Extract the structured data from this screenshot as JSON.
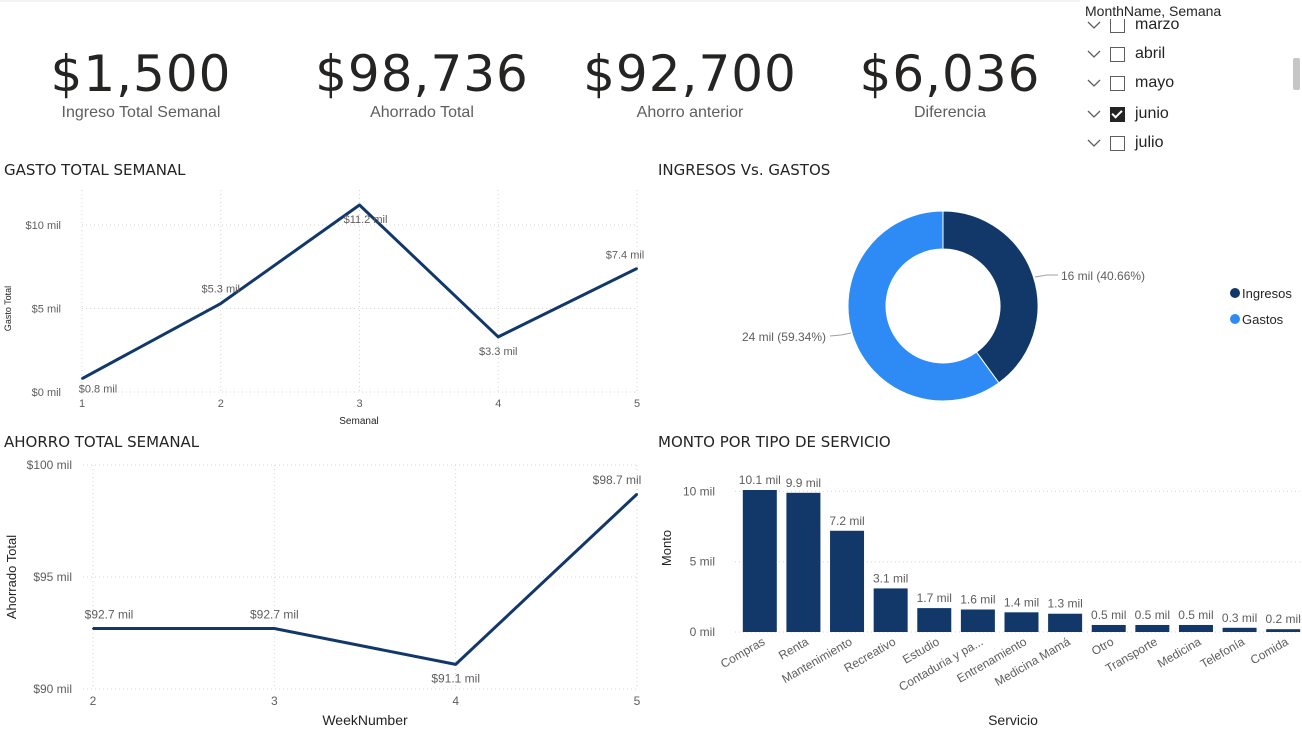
{
  "kpis": [
    {
      "value": "$1,500",
      "label": "Ingreso Total Semanal"
    },
    {
      "value": "$98,736",
      "label": "Ahorrado Total"
    },
    {
      "value": "$92,700",
      "label": "Ahorro anterior"
    },
    {
      "value": "$6,036",
      "label": "Diferencia"
    }
  ],
  "slicer": {
    "header": "MonthName, Semana",
    "items": [
      {
        "label": "marzo",
        "checked": false
      },
      {
        "label": "abril",
        "checked": false
      },
      {
        "label": "mayo",
        "checked": false
      },
      {
        "label": "junio",
        "checked": true
      },
      {
        "label": "julio",
        "checked": false
      }
    ]
  },
  "colors": {
    "dark_blue": "#12386A",
    "light_blue": "#2E8BF6",
    "grid": "#d6d6d6"
  },
  "chart_data": [
    {
      "id": "gasto",
      "type": "line",
      "title": "GASTO TOTAL SEMANAL",
      "xlabel": "Semanal",
      "ylabel": "Gasto Total",
      "x": [
        1,
        2,
        3,
        4,
        5
      ],
      "values": [
        0.8,
        5.3,
        11.2,
        3.3,
        7.4
      ],
      "labels": [
        "$0.8 mil",
        "$5.3 mil",
        "$11.2 mil",
        "$3.3 mil",
        "$7.4 mil"
      ],
      "yticks": [
        0,
        5,
        10
      ],
      "ytick_labels": [
        "$0 mil",
        "$5 mil",
        "$10 mil"
      ],
      "ylim": [
        0,
        11.2
      ],
      "grid": true
    },
    {
      "id": "ahorro",
      "type": "line",
      "title": "AHORRO TOTAL SEMANAL",
      "xlabel": "WeekNumber",
      "ylabel": "Ahorrado Total",
      "x": [
        2,
        3,
        4,
        5
      ],
      "values": [
        92.7,
        92.7,
        91.1,
        98.7
      ],
      "labels": [
        "$92.7 mil",
        "$92.7 mil",
        "$91.1 mil",
        "$98.7 mil"
      ],
      "yticks": [
        90,
        95,
        100
      ],
      "ytick_labels": [
        "$90 mil",
        "$95 mil",
        "$100 mil"
      ],
      "ylim": [
        90,
        100
      ],
      "grid": true
    },
    {
      "id": "donut",
      "type": "pie",
      "title": "INGRESOS Vs. GASTOS",
      "series": [
        {
          "name": "Ingresos",
          "value": 16,
          "label": "16 mil (40.66%)",
          "color": "#12386A"
        },
        {
          "name": "Gastos",
          "value": 24,
          "label": "24 mil (59.34%)",
          "color": "#2E8BF6"
        }
      ],
      "legend": "right"
    },
    {
      "id": "monto",
      "type": "bar",
      "title": "MONTO POR TIPO DE SERVICIO",
      "xlabel": "Servicio",
      "ylabel": "Monto",
      "categories": [
        "Compras",
        "Renta",
        "Mantenimiento",
        "Recreativo",
        "Estudio",
        "Contaduria y pa...",
        "Entrenamiento",
        "Medicina Mamá",
        "Otro",
        "Transporte",
        "Medicina",
        "Telefonía",
        "Comida"
      ],
      "values": [
        10.1,
        9.9,
        7.2,
        3.1,
        1.7,
        1.6,
        1.4,
        1.3,
        0.5,
        0.5,
        0.5,
        0.3,
        0.2
      ],
      "labels": [
        "10.1 mil",
        "9.9 mil",
        "7.2 mil",
        "3.1 mil",
        "1.7 mil",
        "1.6 mil",
        "1.4 mil",
        "1.3 mil",
        "0.5 mil",
        "0.5 mil",
        "0.5 mil",
        "0.3 mil",
        "0.2 mil"
      ],
      "yticks": [
        0,
        5,
        10
      ],
      "ytick_labels": [
        "0 mil",
        "5 mil",
        "10 mil"
      ],
      "ylim": [
        0,
        10.1
      ],
      "grid": true
    }
  ]
}
